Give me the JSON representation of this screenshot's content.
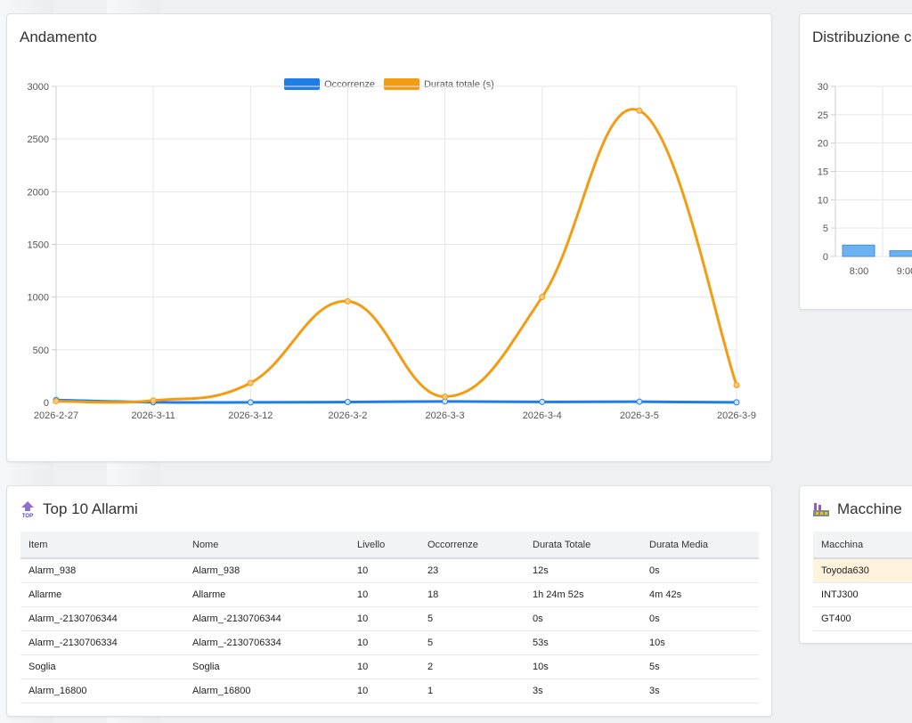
{
  "trend": {
    "title": "Andamento",
    "legend": [
      {
        "label": "Occorrenze",
        "color": "#1e7ee6"
      },
      {
        "label": "Durata totale (s)",
        "color": "#f39c12"
      }
    ]
  },
  "chart_data": [
    {
      "type": "line",
      "categories": [
        "2026-2-27",
        "2026-3-11",
        "2026-3-12",
        "2026-3-2",
        "2026-3-3",
        "2026-3-4",
        "2026-3-5",
        "2026-3-9"
      ],
      "series": [
        {
          "name": "Occorrenze",
          "color": "#1e7ee6",
          "values": [
            23,
            2,
            1,
            4,
            10,
            5,
            7,
            1
          ]
        },
        {
          "name": "Durata totale (s)",
          "color": "#f39c12",
          "values": [
            12,
            18,
            185,
            960,
            55,
            1000,
            2770,
            165
          ]
        }
      ],
      "ylim": [
        0,
        3000
      ],
      "yticks": [
        0,
        500,
        1000,
        1500,
        2000,
        2500,
        3000
      ],
      "grid": true,
      "legend": "top-center"
    },
    {
      "type": "bar",
      "categories": [
        "8:00",
        "9:00"
      ],
      "values": [
        2,
        1
      ],
      "ylim": [
        0,
        30
      ],
      "yticks": [
        0,
        5,
        10,
        15,
        20,
        25,
        30
      ],
      "color": "#6ab2f2",
      "grid": true
    }
  ],
  "dist": {
    "title": "Distribuzione c"
  },
  "top": {
    "title": "Top 10 Allarmi",
    "icon": "top-arrow-icon",
    "columns": [
      "Item",
      "Nome",
      "Livello",
      "Occorrenze",
      "Durata Totale",
      "Durata Media"
    ],
    "rows": [
      [
        "Alarm_938",
        "Alarm_938",
        "10",
        "23",
        "12s",
        "0s"
      ],
      [
        "Allarme",
        "Allarme",
        "10",
        "18",
        "1h 24m 52s",
        "4m 42s"
      ],
      [
        "Alarm_-2130706344",
        "Alarm_-2130706344",
        "10",
        "5",
        "0s",
        "0s"
      ],
      [
        "Alarm_-2130706334",
        "Alarm_-2130706334",
        "10",
        "5",
        "53s",
        "10s"
      ],
      [
        "Soglia",
        "Soglia",
        "10",
        "2",
        "10s",
        "5s"
      ],
      [
        "Alarm_16800",
        "Alarm_16800",
        "10",
        "1",
        "3s",
        "3s"
      ]
    ]
  },
  "machines": {
    "title": "Macchine",
    "icon": "factory-icon",
    "columns": [
      "Macchina"
    ],
    "rows": [
      [
        "Toyoda630"
      ],
      [
        "INTJ300"
      ],
      [
        "GT400"
      ]
    ]
  }
}
